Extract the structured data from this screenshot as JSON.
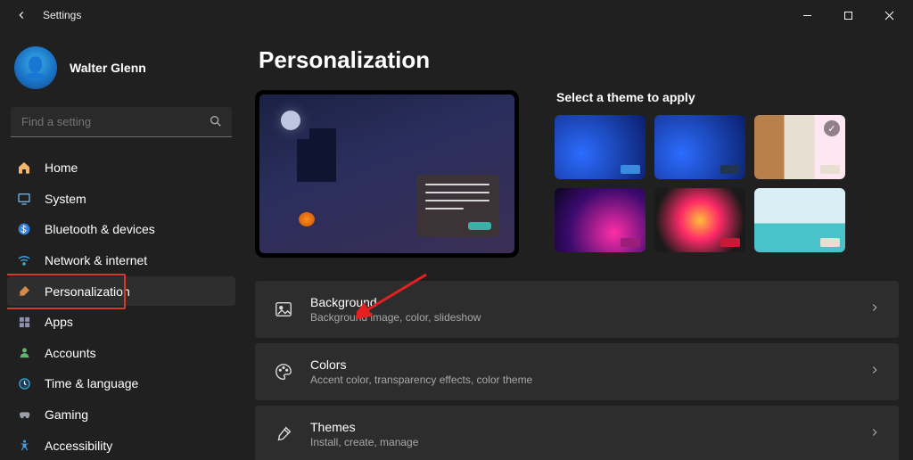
{
  "window": {
    "title": "Settings"
  },
  "user": {
    "name": "Walter Glenn"
  },
  "search": {
    "placeholder": "Find a setting"
  },
  "sidebar": {
    "items": [
      {
        "label": "Home",
        "icon": "home-icon"
      },
      {
        "label": "System",
        "icon": "system-icon"
      },
      {
        "label": "Bluetooth & devices",
        "icon": "bluetooth-icon"
      },
      {
        "label": "Network & internet",
        "icon": "wifi-icon"
      },
      {
        "label": "Personalization",
        "icon": "brush-icon",
        "active": true
      },
      {
        "label": "Apps",
        "icon": "apps-icon"
      },
      {
        "label": "Accounts",
        "icon": "person-icon"
      },
      {
        "label": "Time & language",
        "icon": "clock-icon"
      },
      {
        "label": "Gaming",
        "icon": "gamepad-icon"
      },
      {
        "label": "Accessibility",
        "icon": "accessibility-icon"
      }
    ]
  },
  "page": {
    "title": "Personalization",
    "themes_title": "Select a theme to apply"
  },
  "settings_rows": [
    {
      "title": "Background",
      "desc": "Background image, color, slideshow",
      "icon": "image-icon"
    },
    {
      "title": "Colors",
      "desc": "Accent color, transparency effects, color theme",
      "icon": "palette-icon"
    },
    {
      "title": "Themes",
      "desc": "Install, create, manage",
      "icon": "themes-brush-icon"
    }
  ],
  "annotations": {
    "highlight": "sidebar Personalization item",
    "arrow_target": "Background row"
  }
}
